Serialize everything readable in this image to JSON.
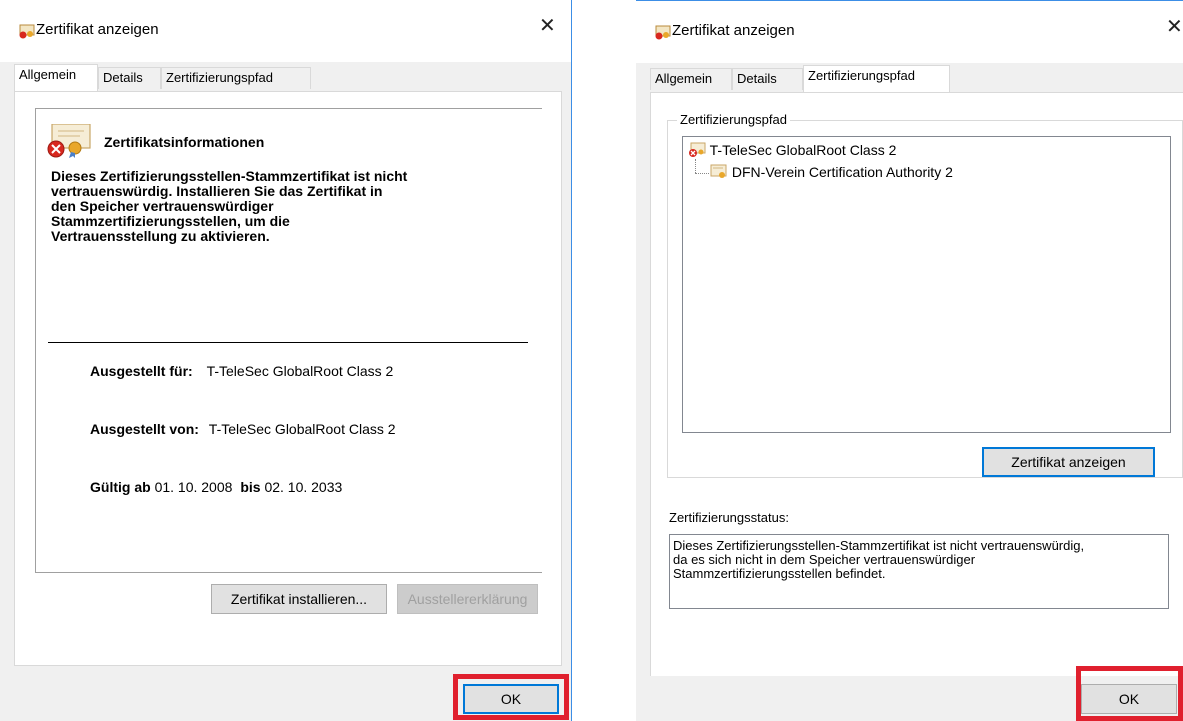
{
  "left_dialog": {
    "title": "Zertifikat anzeigen",
    "tabs": [
      "Allgemein",
      "Details",
      "Zertifizierungspfad"
    ],
    "info_heading": "Zertifikatsinformationen",
    "warning_lines": [
      "Dieses Zertifizierungsstellen-Stammzertifikat ist nicht",
      "vertrauenswürdig. Installieren Sie das Zertifikat in",
      "den Speicher vertrauenswürdiger",
      "Stammzertifizierungsstellen, um die",
      "Vertrauensstellung zu aktivieren."
    ],
    "issued_to_label": "Ausgestellt für:",
    "issued_to_value": "T-TeleSec GlobalRoot Class 2",
    "issued_by_label": "Ausgestellt von:",
    "issued_by_value": "T-TeleSec GlobalRoot Class 2",
    "valid_from_label": "Gültig ab",
    "valid_from_value": "01. 10. 2008",
    "valid_to_label": "bis",
    "valid_to_value": "02. 10. 2033",
    "install_button": "Zertifikat installieren...",
    "issuer_statement_button": "Ausstellererklärung",
    "ok_button": "OK"
  },
  "right_dialog": {
    "title": "Zertifikat anzeigen",
    "tabs": [
      "Allgemein",
      "Details",
      "Zertifizierungspfad"
    ],
    "group_label": "Zertifizierungspfad",
    "tree": [
      "T-TeleSec GlobalRoot Class 2",
      "DFN-Verein Certification Authority 2"
    ],
    "view_cert_button": "Zertifikat anzeigen",
    "status_label": "Zertifizierungsstatus:",
    "status_lines": [
      "Dieses Zertifizierungsstellen-Stammzertifikat ist nicht vertrauenswürdig,",
      "da es sich nicht in dem Speicher vertrauenswürdiger",
      "Stammzertifizierungsstellen befindet."
    ],
    "ok_button": "OK"
  },
  "colors": {
    "highlight_box": "#e0202e",
    "accent": "#0078d7"
  }
}
